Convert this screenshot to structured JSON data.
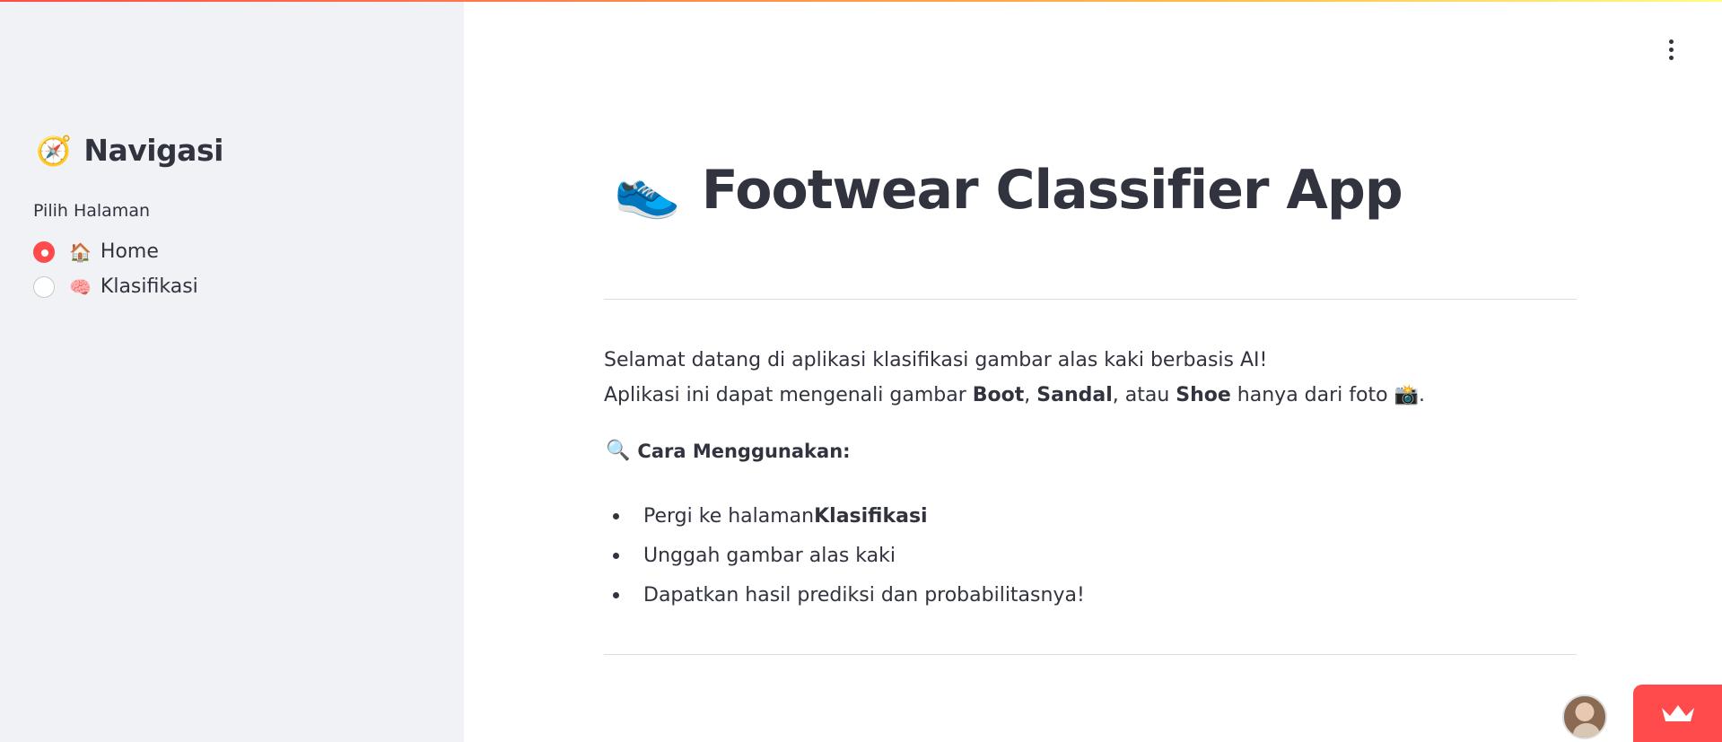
{
  "sidebar": {
    "title": "Navigasi",
    "title_icon": "🧭",
    "radio_label": "Pilih Halaman",
    "options": [
      {
        "label": "Home",
        "emoji": "🏠",
        "selected": true
      },
      {
        "label": "Klasifikasi",
        "emoji": "🧠",
        "selected": false
      }
    ]
  },
  "main": {
    "title": "Footwear Classifier App",
    "title_icon": "👟",
    "intro_line1": "Selamat datang di aplikasi klasifikasi gambar alas kaki berbasis AI!",
    "intro_line2": {
      "prefix": "Aplikasi ini dapat mengenali gambar ",
      "boot": "Boot",
      "comma1": ", ",
      "sandal": "Sandal",
      "comma2": ", atau ",
      "shoe": "Shoe",
      "suffix": " hanya dari foto ",
      "camera": "📸",
      "end": "."
    },
    "how_to_title": "Cara Menggunakan:",
    "how_to_icon": "🔍",
    "steps": [
      {
        "prefix": "Pergi ke halaman ",
        "bold": "Klasifikasi"
      },
      {
        "prefix": "Unggah gambar alas kaki",
        "bold": ""
      },
      {
        "prefix": "Dapatkan hasil prediksi dan probabilitasnya!",
        "bold": ""
      }
    ]
  },
  "icons": {
    "menu": "vertical-ellipsis-icon",
    "crown": "crown-icon",
    "avatar": "user-avatar"
  },
  "colors": {
    "accent": "#ff4b4b",
    "sidebar_bg": "#f0f2f6",
    "text": "#31333f"
  }
}
